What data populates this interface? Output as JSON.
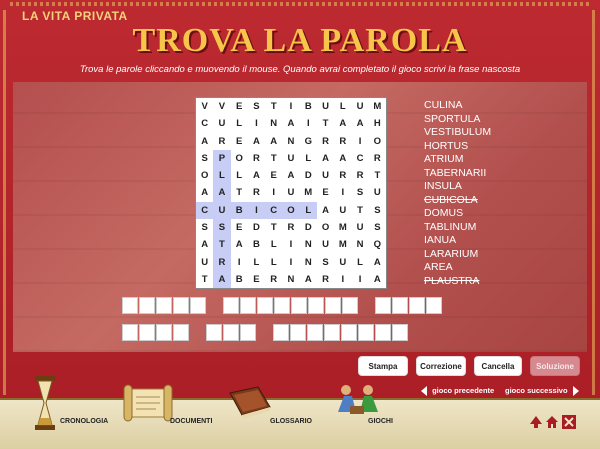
{
  "header": {
    "brand": "LA VITA PRIVATA",
    "title": "TROVA LA PAROLA",
    "instruction": "Trova le parole cliccando e muovendo il mouse. Quando avrai completato il gioco scrivi la frase nascosta"
  },
  "grid": {
    "rows": [
      "VVESTIBULUM",
      "CULINAITAAH",
      "AREAANGRRIO",
      "SPORTULAACR",
      "OLLAEADURRT",
      "AATRIUMEISU",
      "CUBICOLAUTS",
      "SSEDTRDOMUS",
      "ATABLINUMNQ",
      "URILLINSULA",
      "TABERNARIIA"
    ],
    "highlight_cols": [
      1
    ],
    "highlight_from_row": 3,
    "highlight_row": 6,
    "highlight_row_len": 7
  },
  "words": [
    {
      "text": "CULINA",
      "found": false
    },
    {
      "text": "SPORTULA",
      "found": false
    },
    {
      "text": "VESTIBULUM",
      "found": false
    },
    {
      "text": "HORTUS",
      "found": false
    },
    {
      "text": "ATRIUM",
      "found": false
    },
    {
      "text": "TABERNARII",
      "found": false
    },
    {
      "text": "INSULA",
      "found": false
    },
    {
      "text": "CUBICOLA",
      "found": true
    },
    {
      "text": "DOMUS",
      "found": false
    },
    {
      "text": "TABLINUM",
      "found": false
    },
    {
      "text": "IANUA",
      "found": false
    },
    {
      "text": "LARARIUM",
      "found": false
    },
    {
      "text": "AREA",
      "found": false
    },
    {
      "text": "PLAUSTRA",
      "found": true
    }
  ],
  "phrase": {
    "line1": [
      5,
      8,
      4
    ],
    "line2": [
      4,
      3,
      8
    ]
  },
  "buttons": {
    "stampa": "Stampa",
    "correzione": "Correzione",
    "cancella": "Cancella",
    "soluzione": "Soluzione"
  },
  "nav": {
    "prev": "gioco precedente",
    "next": "gioco successivo"
  },
  "footer": {
    "cronologia": "CRONOLOGIA",
    "documenti": "DOCUMENTI",
    "glossario": "GLOSSARIO",
    "giochi": "GIOCHI"
  },
  "colors": {
    "background": "#b3212a",
    "title": "#f6c54a",
    "highlight": "#c8cdf5"
  }
}
